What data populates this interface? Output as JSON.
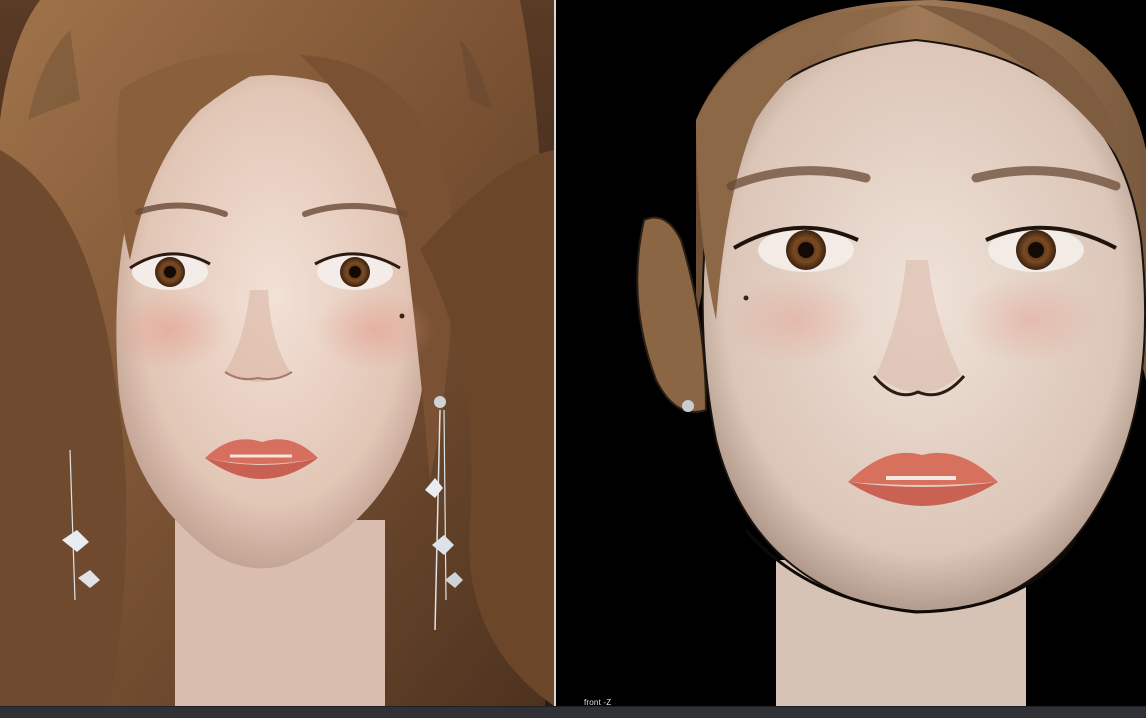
{
  "viewport": {
    "label": "front -Z"
  },
  "panes": {
    "left": {
      "content": "rendered-character-portrait"
    },
    "right": {
      "content": "sculpt-viewport-front-view"
    }
  },
  "colors": {
    "viewport_bg": "#000000",
    "statusbar_bg": "#2f3136",
    "divider": "#d8d8d8"
  }
}
